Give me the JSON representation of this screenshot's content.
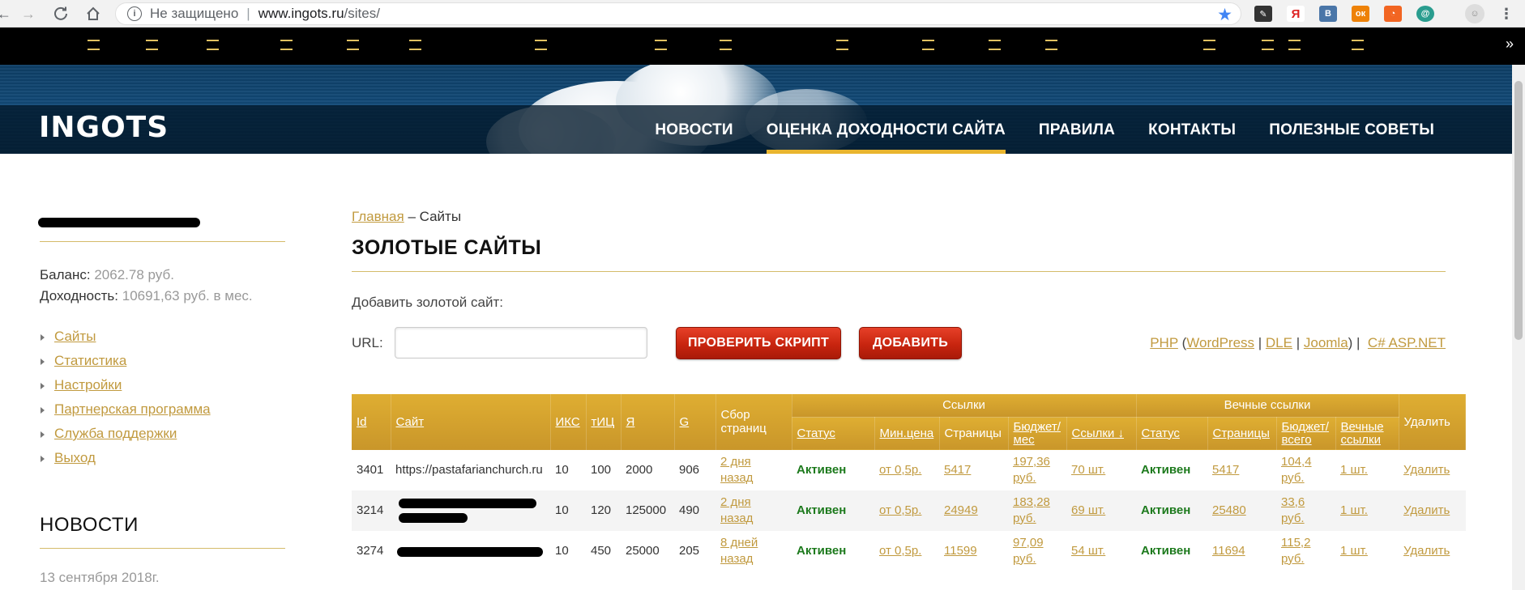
{
  "browser": {
    "security_label": "Не защищено",
    "url_host": "www.ingots.ru",
    "url_path": "/sites/",
    "bookmarks_more": "»"
  },
  "site": {
    "logo": "INGOTS",
    "nav": [
      {
        "label": "НОВОСТИ",
        "active": false
      },
      {
        "label": "ОЦЕНКА ДОХОДНОСТИ САЙТА",
        "active": true
      },
      {
        "label": "ПРАВИЛА",
        "active": false
      },
      {
        "label": "КОНТАКТЫ",
        "active": false
      },
      {
        "label": "ПОЛЕЗНЫЕ СОВЕТЫ",
        "active": false
      }
    ],
    "accent_color": "#e9b52e"
  },
  "sidebar": {
    "balance_label": "Баланс:",
    "balance_value": "2062.78 руб.",
    "income_label": "Доходность:",
    "income_value": "10691,63 руб. в мес.",
    "menu": [
      "Сайты",
      "Статистика",
      "Настройки",
      "Партнерская программа",
      "Служба поддержки",
      "Выход"
    ],
    "news_title": "НОВОСТИ",
    "news_date": "13 сентября 2018г."
  },
  "main": {
    "breadcrumb_home": "Главная",
    "breadcrumb_sep": " – ",
    "breadcrumb_current": "Сайты",
    "title": "ЗОЛОТЫЕ САЙТЫ",
    "add_label": "Добавить золотой сайт:",
    "url_label": "URL:",
    "url_value": "",
    "check_button": "ПРОВЕРИТЬ СКРИПТ",
    "add_button": "ДОБАВИТЬ",
    "platforms": {
      "php": "PHP",
      "wordpress": "WordPress",
      "dle": "DLE",
      "joomla": "Joomla",
      "aspnet": "C# ASP.NET"
    }
  },
  "table": {
    "group_links": "Ссылки",
    "group_eternal": "Вечные ссылки",
    "headers": {
      "id": "Id",
      "site": "Сайт",
      "iks": "ИКС",
      "tic": "тИЦ",
      "ya": "Я",
      "g": "G",
      "collect": "Сбор страниц",
      "status": "Статус",
      "min_price": "Мин.цена",
      "pages": "Страницы",
      "budget_month": "Бюджет/ мес",
      "links": "Ссылки ↓",
      "e_status": "Статус",
      "e_pages": "Страницы",
      "e_budget": "Бюджет/ всего",
      "e_links": "Вечные ссылки",
      "delete": "Удалить"
    },
    "rows": [
      {
        "id": "3401",
        "site": "https://pastafarianchurch.ru",
        "iks": "10",
        "tic": "100",
        "ya": "2000",
        "g": "906",
        "collect": "2 дня назад",
        "status": "Активен",
        "min_price": "от 0,5р.",
        "pages": "5417",
        "budget": "197,36 руб.",
        "links": "70 шт.",
        "e_status": "Активен",
        "e_pages": "5417",
        "e_budget": "104,4 руб.",
        "e_links": "1 шт.",
        "delete": "Удалить"
      },
      {
        "id": "3214",
        "site": "",
        "iks": "10",
        "tic": "120",
        "ya": "125000",
        "g": "490",
        "collect": "2 дня назад",
        "status": "Активен",
        "min_price": "от 0,5р.",
        "pages": "24949",
        "budget": "183,28 руб.",
        "links": "69 шт.",
        "e_status": "Активен",
        "e_pages": "25480",
        "e_budget": "33,6 руб.",
        "e_links": "1 шт.",
        "delete": "Удалить"
      },
      {
        "id": "3274",
        "site": "",
        "iks": "10",
        "tic": "450",
        "ya": "25000",
        "g": "205",
        "collect": "8 дней назад",
        "status": "Активен",
        "min_price": "от 0,5р.",
        "pages": "11599",
        "budget": "97,09 руб.",
        "links": "54 шт.",
        "e_status": "Активен",
        "e_pages": "11694",
        "e_budget": "115,2 руб.",
        "e_links": "1 шт.",
        "delete": "Удалить"
      }
    ]
  }
}
